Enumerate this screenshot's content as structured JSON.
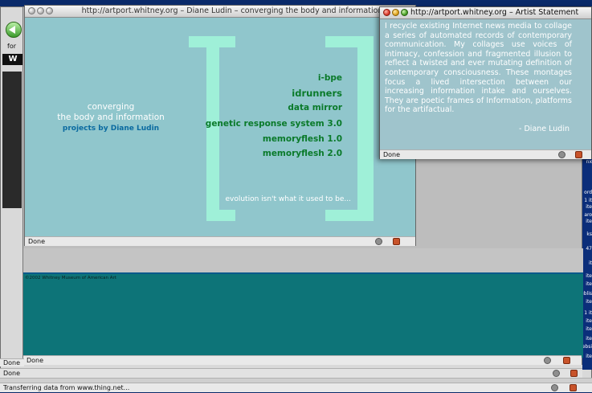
{
  "artist_window": {
    "url_title": "http://artport.whitney.org – Diane Ludin – converging the body and information",
    "heading_line1": "converging",
    "heading_line2": "the body and information",
    "byline": "projects by Diane Ludin",
    "projects": [
      "i-bpe",
      "idrunners",
      "data mirror",
      "genetic response system 3.0",
      "memoryflesh 1.0",
      "memoryflesh 2.0"
    ],
    "tagline": "evolution isn't what it used to be...",
    "status": "Done"
  },
  "statement_window": {
    "title": "http://artport.whitney.org – Artist Statement",
    "text": "I recycle existing Internet news media to collage a series of automated records of contemporary communication. My collages use voices of intimacy, confession and fragmented illusion to reflect a twisted and ever mutating definition of contemporary consciousness. These montages focus a lived intersection between our increasing information intake and ourselves. They are poetic frames of Information, platforms for the artifactual.",
    "signature": "- Diane Ludin",
    "status": "Done"
  },
  "whitney_window": {
    "copyright": "©2002 Whitney Museum of American Art",
    "status": "Done"
  },
  "back_windows": {
    "status_1": "Done",
    "status_2": "Done",
    "status_3": "Done",
    "left_label": "for",
    "left_label2": "W"
  },
  "bottom_status": "Transferring data from www.thing.net...",
  "right_strip_labels": [
    "nx",
    "ord",
    "1 it",
    "ite",
    "aro",
    "ite",
    "ks",
    "47",
    "it",
    "ite",
    "ite",
    "ublis",
    "ite",
    "1 it",
    "ite",
    "ite",
    "ite",
    "ebsi",
    "ite"
  ],
  "colors": {
    "artist_bg": "#90c6cc",
    "statement_bg": "#9fc4cc",
    "teal": "#0d7478",
    "link_green": "#0a7a2a",
    "bracket": "#9ff0d8"
  }
}
